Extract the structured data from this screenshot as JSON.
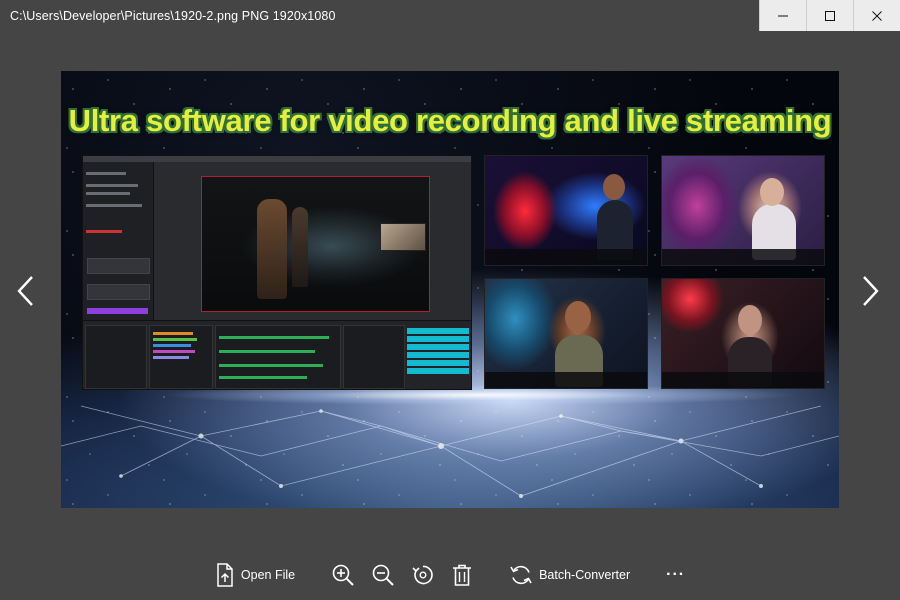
{
  "window": {
    "title": "C:\\Users\\Developer\\Pictures\\1920-2.png PNG 1920x1080"
  },
  "image": {
    "banner_text": "Ultra software for video recording and live streaming"
  },
  "toolbar": {
    "open_file_label": "Open File",
    "batch_converter_label": "Batch-Converter",
    "more_label": "···"
  },
  "icons": {
    "minimize": "minimize-icon",
    "maximize": "maximize-icon",
    "close": "close-icon",
    "prev": "chevron-left-icon",
    "next": "chevron-right-icon",
    "open_file": "open-file-icon",
    "zoom_in": "zoom-in-icon",
    "zoom_out": "zoom-out-icon",
    "rotate": "rotate-icon",
    "delete": "trash-icon",
    "batch": "sync-icon"
  },
  "colors": {
    "app_background": "#454545",
    "titlebar_buttons": "#ececec",
    "banner_text": "#e6f03a",
    "banner_outline": "#2f6f3a"
  }
}
